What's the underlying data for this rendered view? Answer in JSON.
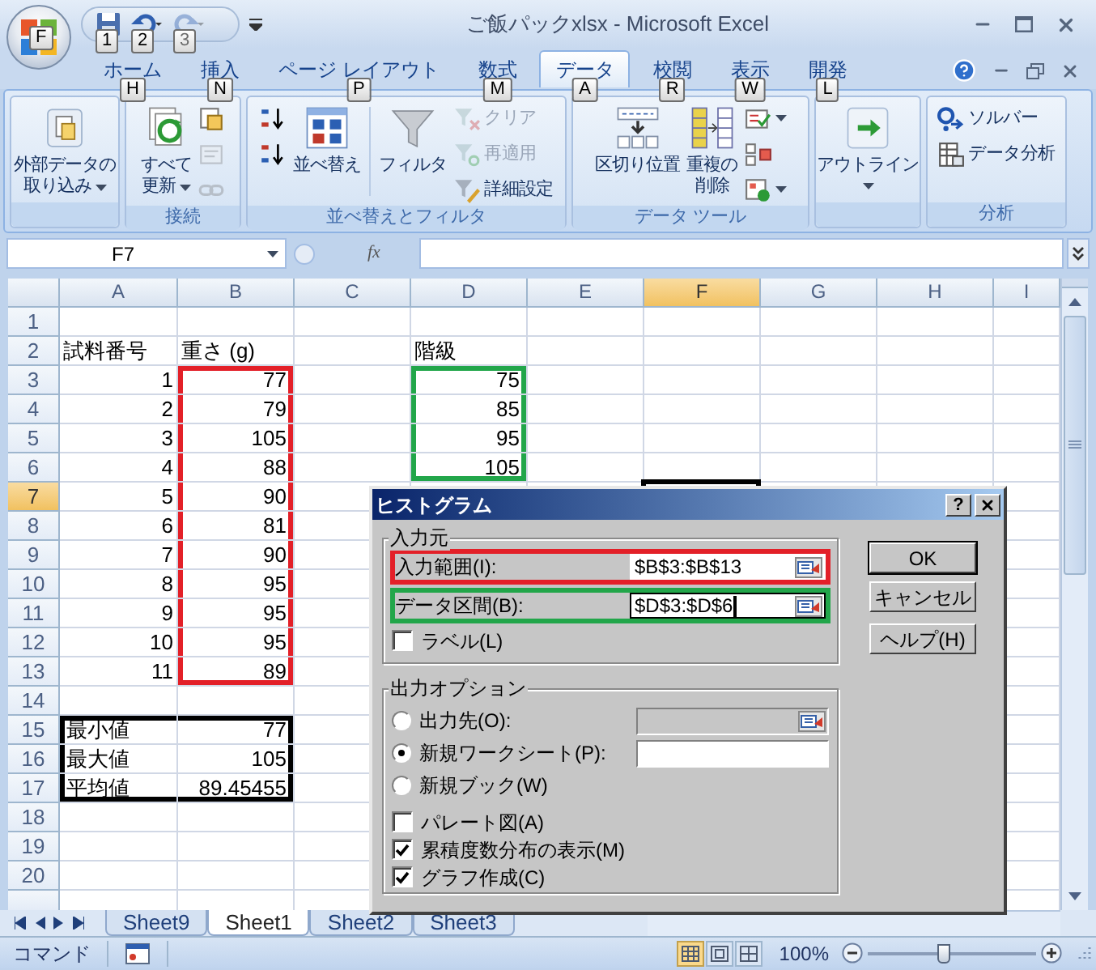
{
  "window": {
    "title": "ご飯パックxlsx - Microsoft Excel",
    "office_keytip": "F"
  },
  "quick_access": [
    {
      "keytip": "1",
      "disabled": false
    },
    {
      "keytip": "2",
      "disabled": false
    },
    {
      "keytip": "3",
      "disabled": true
    }
  ],
  "tabs": [
    {
      "label": "ホーム",
      "keytip": "H",
      "selected": false
    },
    {
      "label": "挿入",
      "keytip": "N",
      "selected": false
    },
    {
      "label": "ページ レイアウト",
      "keytip": "P",
      "selected": false
    },
    {
      "label": "数式",
      "keytip": "M",
      "selected": false
    },
    {
      "label": "データ",
      "keytip": "A",
      "selected": true
    },
    {
      "label": "校閲",
      "keytip": "R",
      "selected": false
    },
    {
      "label": "表示",
      "keytip": "W",
      "selected": false
    },
    {
      "label": "開発",
      "keytip": "L",
      "selected": false
    }
  ],
  "ribbon_groups": [
    {
      "items": [
        {
          "kind": "large",
          "lines": [
            "外部データの",
            "取り込み"
          ],
          "dropdown": true
        }
      ]
    },
    {
      "label": "接続",
      "items": [
        {
          "kind": "large",
          "lines": [
            "すべて",
            "更新"
          ],
          "dropdown": true
        },
        {
          "kind": "stack",
          "items": [
            {
              "disabled": false
            },
            {
              "disabled": true
            },
            {
              "disabled": true
            }
          ]
        }
      ]
    },
    {
      "label": "並べ替えとフィルタ",
      "items": [
        {
          "kind": "stack",
          "items": [
            {
              "disabled": false
            },
            {
              "disabled": false
            }
          ]
        },
        {
          "kind": "large",
          "lines": [
            "並べ替え"
          ],
          "dropdown": false
        },
        {
          "kind": "divider"
        },
        {
          "kind": "large",
          "lines": [
            "フィルタ"
          ],
          "dropdown": false
        },
        {
          "kind": "stack",
          "items": [
            {
              "label": "クリア",
              "disabled": true
            },
            {
              "label": "再適用",
              "disabled": true
            },
            {
              "label": "詳細設定",
              "disabled": false
            }
          ]
        }
      ]
    },
    {
      "label": "データ ツール",
      "items": [
        {
          "kind": "large",
          "lines": [
            "区切り位置"
          ],
          "dropdown": false
        },
        {
          "kind": "large",
          "lines": [
            "重複の",
            "削除"
          ],
          "dropdown": false
        },
        {
          "kind": "stack",
          "items": [
            {
              "dropdown": true
            },
            {
              "dropdown": false
            },
            {
              "dropdown": true
            }
          ]
        }
      ]
    },
    {
      "items": [
        {
          "kind": "large",
          "lines": [
            "アウトライン"
          ],
          "dropdown": true
        }
      ]
    },
    {
      "label": "分析",
      "items": [
        {
          "kind": "stack",
          "items": [
            {
              "label": "ソルバー"
            },
            {
              "label": "データ分析"
            }
          ]
        }
      ]
    }
  ],
  "name_box": "F7",
  "formula_button": "fx",
  "columns": [
    {
      "label": "A",
      "selected": false
    },
    {
      "label": "B",
      "selected": false
    },
    {
      "label": "C",
      "selected": false
    },
    {
      "label": "D",
      "selected": false
    },
    {
      "label": "E",
      "selected": false
    },
    {
      "label": "F",
      "selected": true
    },
    {
      "label": "G",
      "selected": false
    },
    {
      "label": "H",
      "selected": false
    },
    {
      "label": "I",
      "selected": false
    }
  ],
  "rows": [
    {
      "label": "1",
      "selected": false
    },
    {
      "label": "2",
      "selected": false,
      "cells": [
        {
          "text": "試料番号",
          "kind": "text"
        },
        {
          "text": "重さ (g)",
          "kind": "text"
        },
        null,
        {
          "text": "階級",
          "kind": "text"
        }
      ]
    },
    {
      "label": "3",
      "selected": false,
      "cells": [
        {
          "text": "1",
          "kind": "number"
        },
        {
          "text": "77",
          "kind": "number",
          "color": "#e32028"
        },
        null,
        {
          "text": "75",
          "kind": "number",
          "color": "#22a64a"
        }
      ]
    },
    {
      "label": "4",
      "selected": false,
      "cells": [
        {
          "text": "2",
          "kind": "number"
        },
        {
          "text": "79",
          "kind": "number",
          "color": "#e32028"
        },
        null,
        {
          "text": "85",
          "kind": "number",
          "color": "#22a64a"
        }
      ]
    },
    {
      "label": "5",
      "selected": false,
      "cells": [
        {
          "text": "3",
          "kind": "number"
        },
        {
          "text": "105",
          "kind": "number",
          "color": "#e32028"
        },
        null,
        {
          "text": "95",
          "kind": "number",
          "color": "#22a64a"
        }
      ]
    },
    {
      "label": "6",
      "selected": false,
      "cells": [
        {
          "text": "4",
          "kind": "number"
        },
        {
          "text": "88",
          "kind": "number",
          "color": "#e32028"
        },
        null,
        {
          "text": "105",
          "kind": "number",
          "color": "#22a64a"
        }
      ]
    },
    {
      "label": "7",
      "selected": true,
      "cells": [
        {
          "text": "5",
          "kind": "number"
        },
        {
          "text": "90",
          "kind": "number",
          "color": "#e32028"
        }
      ]
    },
    {
      "label": "8",
      "selected": false,
      "cells": [
        {
          "text": "6",
          "kind": "number"
        },
        {
          "text": "81",
          "kind": "number",
          "color": "#e32028"
        }
      ]
    },
    {
      "label": "9",
      "selected": false,
      "cells": [
        {
          "text": "7",
          "kind": "number"
        },
        {
          "text": "90",
          "kind": "number",
          "color": "#e32028"
        }
      ]
    },
    {
      "label": "10",
      "selected": false,
      "cells": [
        {
          "text": "8",
          "kind": "number"
        },
        {
          "text": "95",
          "kind": "number",
          "color": "#e32028"
        }
      ]
    },
    {
      "label": "11",
      "selected": false,
      "cells": [
        {
          "text": "9",
          "kind": "number"
        },
        {
          "text": "95",
          "kind": "number",
          "color": "#e32028"
        }
      ]
    },
    {
      "label": "12",
      "selected": false,
      "cells": [
        {
          "text": "10",
          "kind": "number"
        },
        {
          "text": "95",
          "kind": "number",
          "color": "#e32028"
        }
      ]
    },
    {
      "label": "13",
      "selected": false,
      "cells": [
        {
          "text": "11",
          "kind": "number"
        },
        {
          "text": "89",
          "kind": "number",
          "color": "#e32028"
        }
      ]
    },
    {
      "label": "14",
      "selected": false
    },
    {
      "label": "15",
      "selected": false,
      "cells": [
        {
          "text": "最小値",
          "kind": "text",
          "color": "#000000"
        },
        {
          "text": "77",
          "kind": "number",
          "color": "#000000"
        }
      ]
    },
    {
      "label": "16",
      "selected": false,
      "cells": [
        {
          "text": "最大値",
          "kind": "text",
          "color": "#000000"
        },
        {
          "text": "105",
          "kind": "number",
          "color": "#000000"
        }
      ]
    },
    {
      "label": "17",
      "selected": false,
      "cells": [
        {
          "text": "平均値",
          "kind": "text",
          "color": "#000000"
        },
        {
          "text": "89.45455",
          "kind": "number",
          "color": "#000000"
        }
      ]
    },
    {
      "label": "18",
      "selected": false
    },
    {
      "label": "19",
      "selected": false
    },
    {
      "label": "20",
      "selected": false
    }
  ],
  "sheet_tabs": [
    {
      "label": "Sheet9",
      "selected": false
    },
    {
      "label": "Sheet1",
      "selected": true
    },
    {
      "label": "Sheet2",
      "selected": false
    },
    {
      "label": "Sheet3",
      "selected": false
    }
  ],
  "status_bar": {
    "mode": "コマンド",
    "view_modes": [
      {
        "selected": true
      },
      {
        "selected": false
      },
      {
        "selected": false
      }
    ],
    "zoom": {
      "label": "100%",
      "level": 0.45
    }
  },
  "dialog": {
    "title": "ヒストグラム",
    "help_glyph": "?",
    "input_group": {
      "label": "入力元",
      "fields": [
        {
          "label": "入力範囲(I):",
          "value": "$B$3:$B$13",
          "color": "#e32028",
          "focused": false
        },
        {
          "label": "データ区間(B):",
          "value": "$D$3:$D$6",
          "color": "#22a64a",
          "focused": true
        }
      ],
      "checkbox": {
        "label": "ラベル(L)",
        "checked": false
      }
    },
    "output_group": {
      "label": "出力オプション",
      "radios": [
        {
          "label": "出力先(O):",
          "selected": false,
          "field": {
            "kind": "reference",
            "disabled": true
          }
        },
        {
          "label": "新規ワークシート(P):",
          "selected": true,
          "field": {
            "kind": "text",
            "disabled": false
          }
        },
        {
          "label": "新規ブック(W)",
          "selected": false
        }
      ],
      "checkboxes": [
        {
          "label": "パレート図(A)",
          "checked": false
        },
        {
          "label": "累積度数分布の表示(M)",
          "checked": true
        },
        {
          "label": "グラフ作成(C)",
          "checked": true
        }
      ]
    },
    "buttons": [
      "OK",
      "キャンセル",
      "ヘルプ(H)"
    ]
  }
}
